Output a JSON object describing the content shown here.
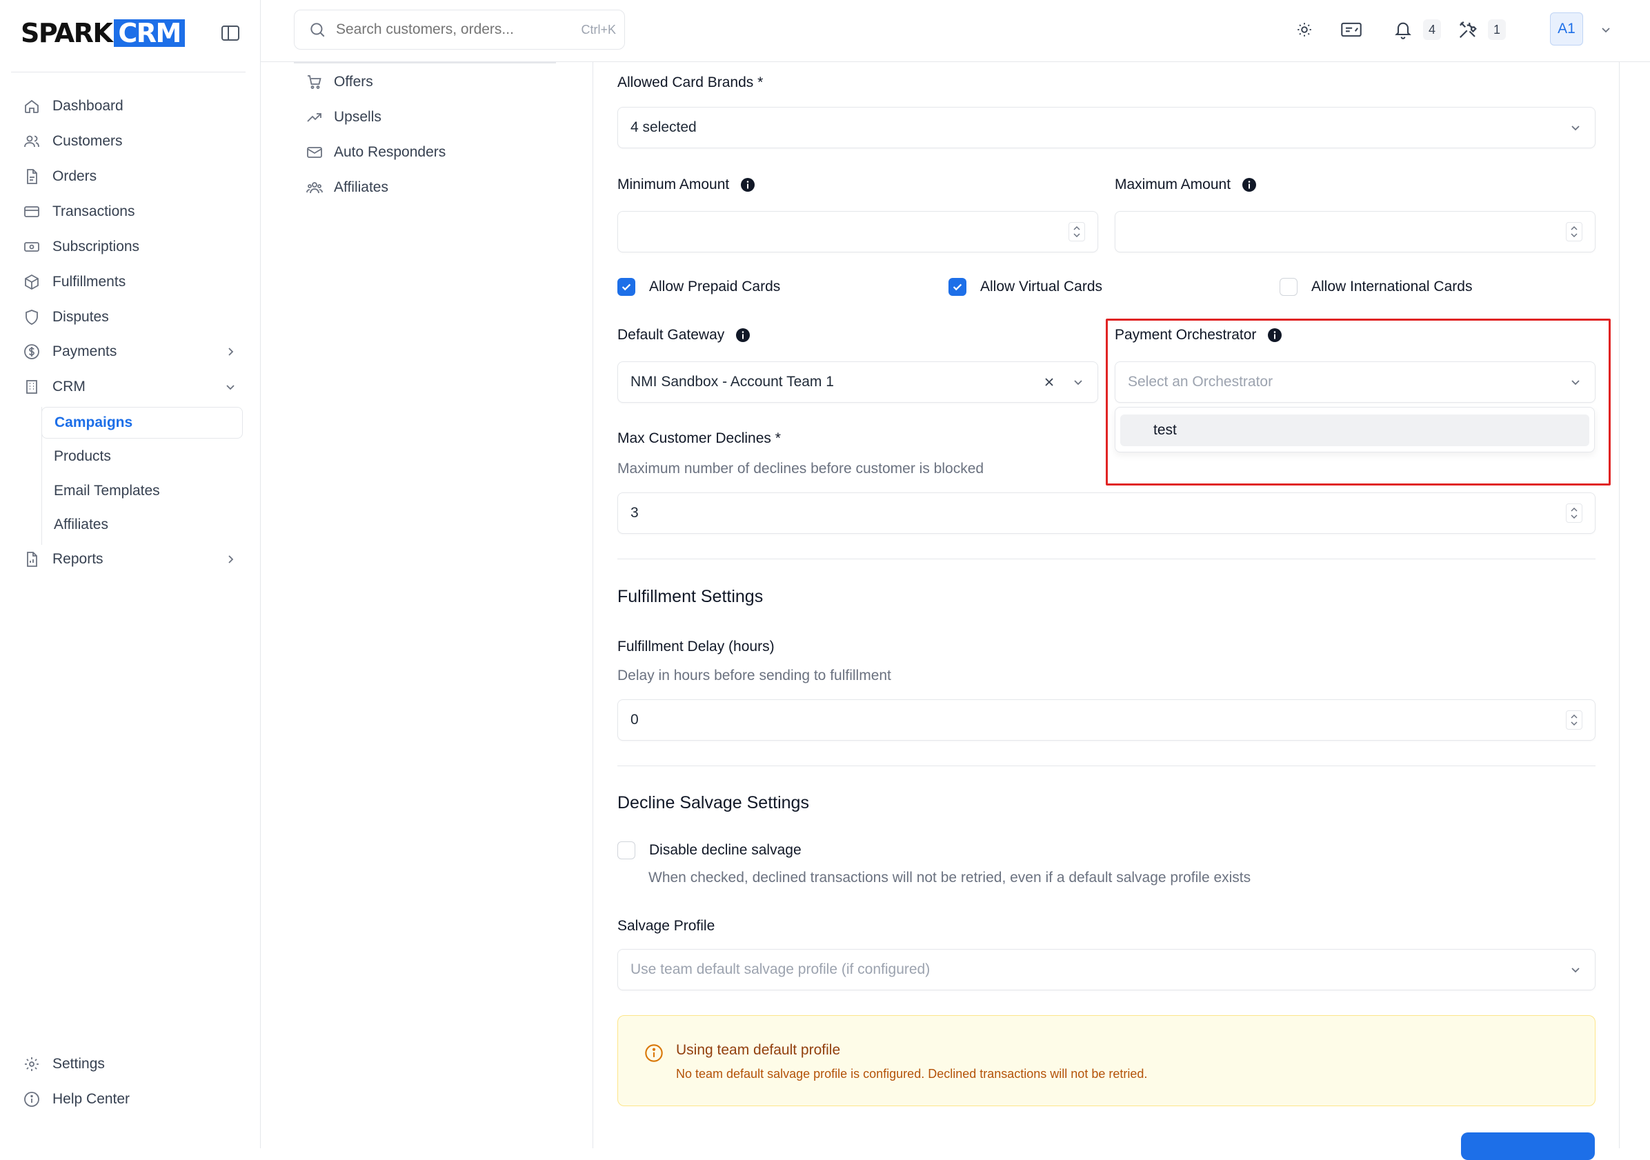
{
  "app": {
    "logo_spark": "SPARK",
    "logo_crm": "CRM"
  },
  "search": {
    "placeholder": "Search customers, orders...",
    "shortcut": "Ctrl+K"
  },
  "topbar": {
    "notifications_count": "4",
    "tools_count": "1",
    "avatar_initials": "A1"
  },
  "sidebar": {
    "items": [
      {
        "label": "Dashboard",
        "icon": "home-icon"
      },
      {
        "label": "Customers",
        "icon": "users-icon"
      },
      {
        "label": "Orders",
        "icon": "file-icon"
      },
      {
        "label": "Transactions",
        "icon": "credit-card-icon"
      },
      {
        "label": "Subscriptions",
        "icon": "banknote-icon"
      },
      {
        "label": "Fulfillments",
        "icon": "package-icon"
      },
      {
        "label": "Disputes",
        "icon": "shield-icon"
      },
      {
        "label": "Payments",
        "icon": "dollar-circle-icon"
      },
      {
        "label": "CRM",
        "icon": "building-icon"
      }
    ],
    "crm_children": [
      "Campaigns",
      "Products",
      "Email Templates",
      "Affiliates"
    ],
    "reports": "Reports",
    "settings": "Settings",
    "help": "Help Center"
  },
  "subnav": {
    "items": [
      "Offers",
      "Upsells",
      "Auto Responders",
      "Affiliates"
    ]
  },
  "form": {
    "allowed_card_brands_label": "Allowed Card Brands *",
    "allowed_card_brands_value": "4 selected",
    "min_amount_label": "Minimum Amount",
    "max_amount_label": "Maximum Amount",
    "min_amount_value": "",
    "max_amount_value": "",
    "allow_prepaid": {
      "label": "Allow Prepaid Cards",
      "checked": true
    },
    "allow_virtual": {
      "label": "Allow Virtual Cards",
      "checked": true
    },
    "allow_international": {
      "label": "Allow International Cards",
      "checked": false
    },
    "default_gateway_label": "Default Gateway",
    "default_gateway_value": "NMI Sandbox - Account Team 1",
    "payment_orchestrator_label": "Payment Orchestrator",
    "payment_orchestrator_placeholder": "Select an Orchestrator",
    "orchestrator_options": [
      "test"
    ],
    "max_declines_label": "Max Customer Declines *",
    "max_declines_help": "Maximum number of declines before customer is blocked",
    "max_declines_value": "3"
  },
  "fulfillment": {
    "title": "Fulfillment Settings",
    "delay_label": "Fulfillment Delay (hours)",
    "delay_help": "Delay in hours before sending to fulfillment",
    "delay_value": "0"
  },
  "salvage": {
    "title": "Decline Salvage Settings",
    "disable_label": "Disable decline salvage",
    "disable_checked": false,
    "disable_help": "When checked, declined transactions will not be retried, even if a default salvage profile exists",
    "profile_label": "Salvage Profile",
    "profile_placeholder": "Use team default salvage profile (if configured)",
    "alert_title": "Using team default profile",
    "alert_desc": "No team default salvage profile is configured. Declined transactions will not be retried."
  },
  "colors": {
    "accent": "#1d6fe8",
    "highlight": "#e02424",
    "alert_bg": "#fefce8",
    "alert_text": "#b45309"
  }
}
